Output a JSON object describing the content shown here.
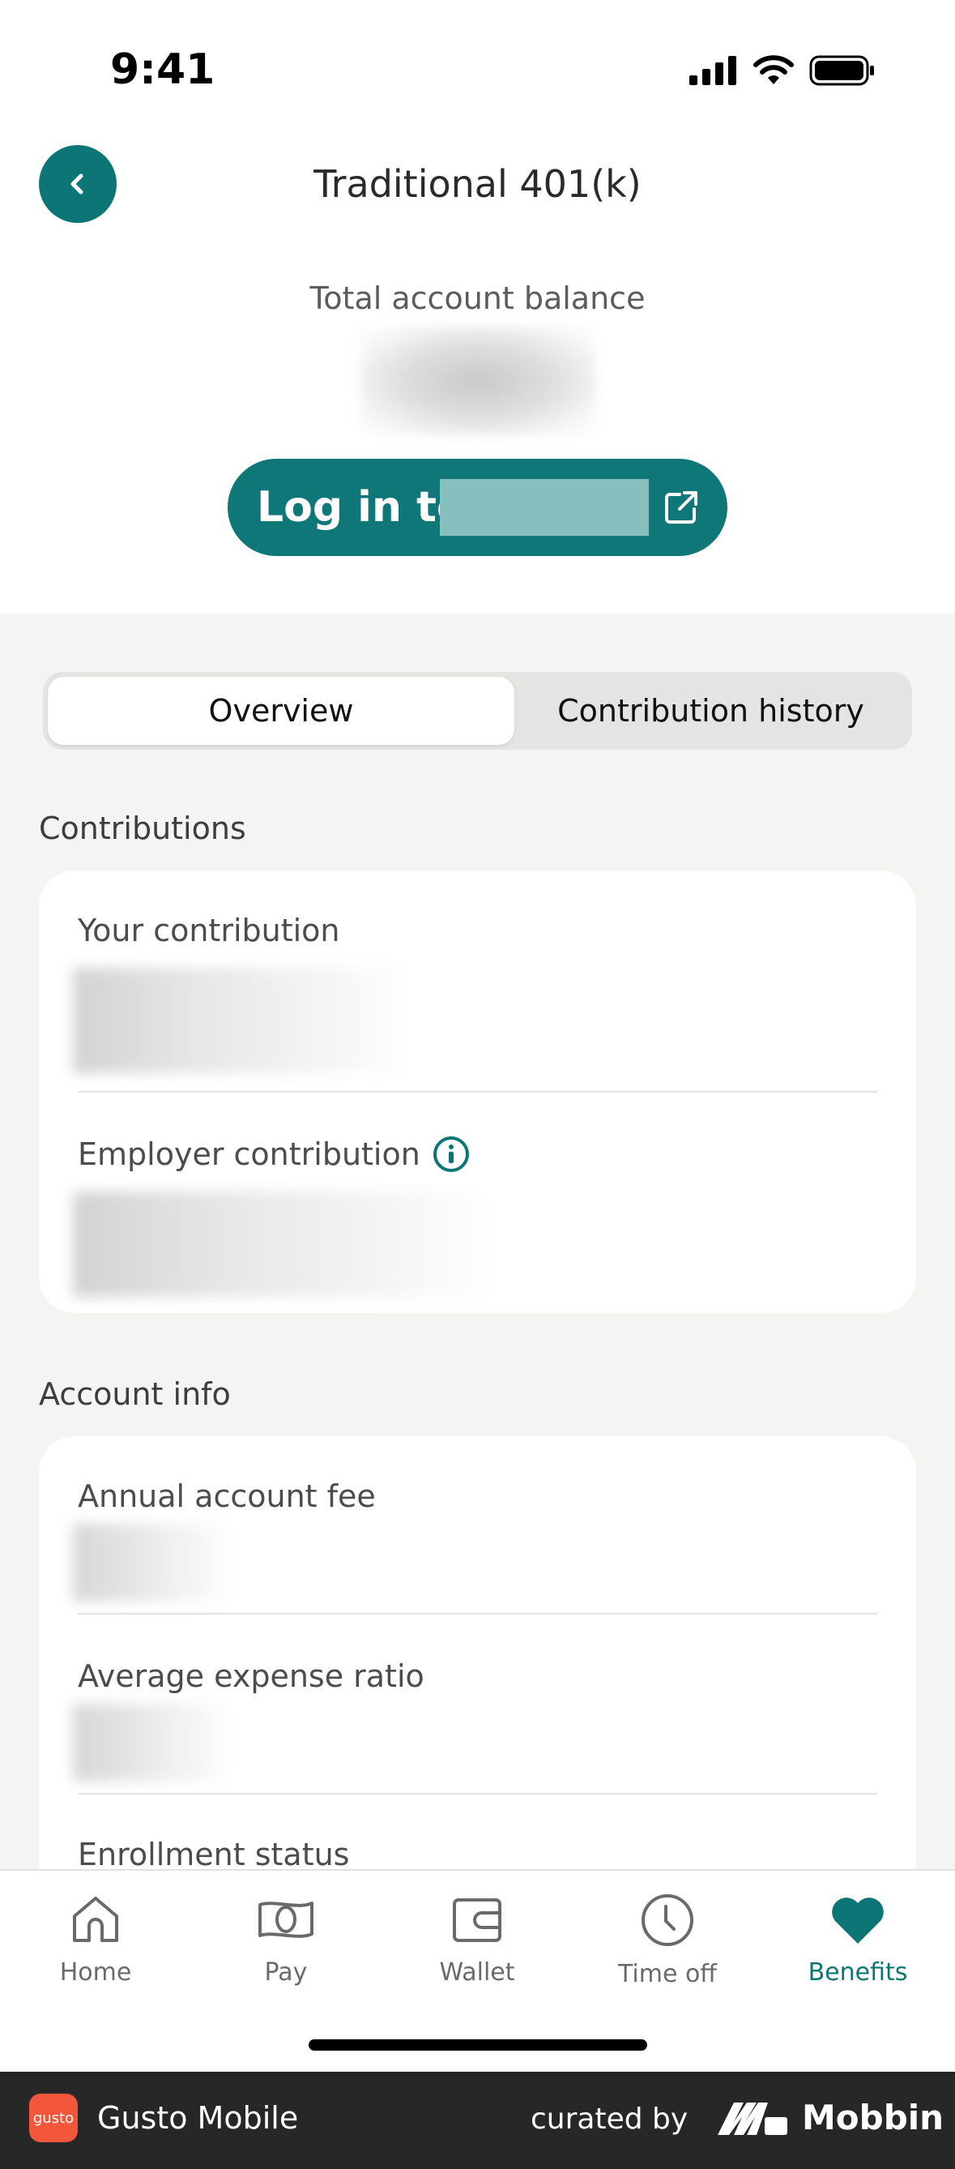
{
  "status_bar": {
    "time": "9:41"
  },
  "header": {
    "title": "Traditional 401(k)"
  },
  "balance": {
    "label": "Total account balance"
  },
  "login": {
    "label": "Log in to"
  },
  "segmented": {
    "tabs": [
      {
        "label": "Overview",
        "active": true
      },
      {
        "label": "Contribution history",
        "active": false
      }
    ]
  },
  "contributions": {
    "title": "Contributions",
    "your_contribution_label": "Your contribution",
    "employer_contribution_label": "Employer contribution"
  },
  "account_info": {
    "title": "Account info",
    "annual_fee_label": "Annual account fee",
    "expense_ratio_label": "Average expense ratio",
    "enrollment_label": "Enrollment status"
  },
  "tab_bar": {
    "items": [
      {
        "label": "Home",
        "icon": "home-icon"
      },
      {
        "label": "Pay",
        "icon": "pay-icon"
      },
      {
        "label": "Wallet",
        "icon": "wallet-icon"
      },
      {
        "label": "Time off",
        "icon": "clock-icon"
      },
      {
        "label": "Benefits",
        "icon": "heart-icon",
        "active": true
      }
    ]
  },
  "footer": {
    "logo_text": "gusto",
    "app_name": "Gusto Mobile",
    "curated_by": "curated by",
    "brand": "Mobbin"
  },
  "colors": {
    "accent": "#0d7575",
    "background": "#f4f4f2",
    "footer": "#272727"
  }
}
